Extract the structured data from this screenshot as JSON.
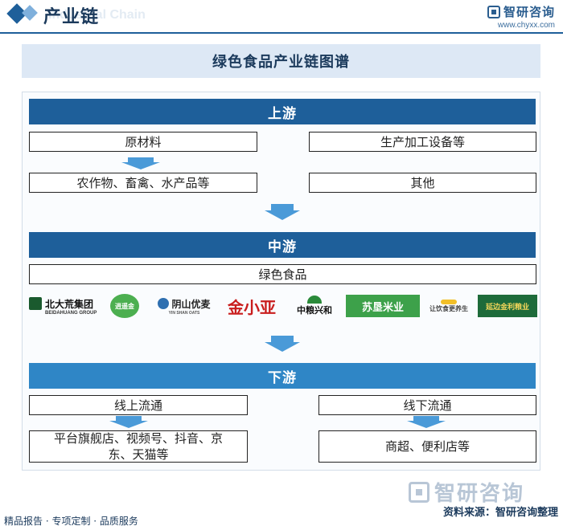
{
  "header": {
    "title": "产业链",
    "ghost_text": "Industrial Chain",
    "brand_name": "智研咨询",
    "brand_url": "www.chyxx.com"
  },
  "diagram_title": "绿色食品产业链图谱",
  "upstream": {
    "label": "上游",
    "left_top": "原材料",
    "left_bottom": "农作物、畜禽、水产品等",
    "right_top": "生产加工设备等",
    "right_bottom": "其他"
  },
  "midstream": {
    "label": "中游",
    "product": "绿色食品",
    "logos": [
      {
        "main": "北大荒集团",
        "sub": "BEIDAHUANG GROUP"
      },
      {
        "main": "逍遥金"
      },
      {
        "main": "阴山优麦",
        "sub": "YIN SHAN OATS"
      },
      {
        "main": "金小亚"
      },
      {
        "main": "中粮兴和"
      },
      {
        "main": "苏垦米业"
      },
      {
        "main": "让饮食更养生"
      },
      {
        "main": "延边金利粮业"
      }
    ]
  },
  "downstream": {
    "label": "下游",
    "online": "线上流通",
    "online_detail": "平台旗舰店、视频号、抖音、京东、天猫等",
    "offline": "线下流通",
    "offline_detail": "商超、便利店等"
  },
  "footer": {
    "tagline": "精品报告 · 专项定制 · 品质服务",
    "source": "资料来源：智研咨询整理",
    "watermark_brand": "智研咨询"
  },
  "colors": {
    "primary": "#1e5f9a",
    "secondary": "#2f86c6",
    "arrow": "#4a9ad8",
    "band": "#dde8f5"
  }
}
